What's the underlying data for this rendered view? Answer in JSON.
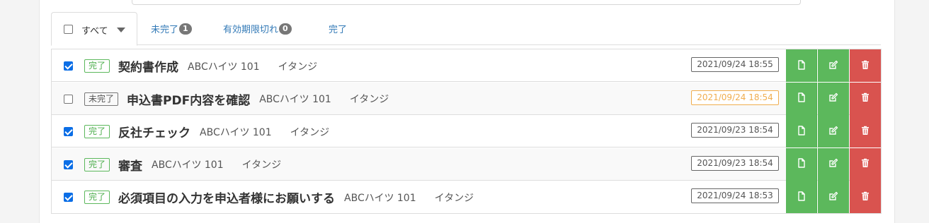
{
  "tabs": {
    "all_label": "すべて",
    "incomplete_label": "未完了",
    "incomplete_count": "1",
    "expired_label": "有効期限切れ",
    "expired_count": "0",
    "complete_label": "完了"
  },
  "tasks": [
    {
      "checked": true,
      "status": "完了",
      "title": "契約書作成",
      "property": "ABCハイツ 101",
      "staff": "イタンジ",
      "date": "2021/09/24 18:55",
      "date_warning": false
    },
    {
      "checked": false,
      "status": "未完了",
      "title": "申込書PDF内容を確認",
      "property": "ABCハイツ 101",
      "staff": "イタンジ",
      "date": "2021/09/24 18:54",
      "date_warning": true
    },
    {
      "checked": true,
      "status": "完了",
      "title": "反社チェック",
      "property": "ABCハイツ 101",
      "staff": "イタンジ",
      "date": "2021/09/23 18:54",
      "date_warning": false
    },
    {
      "checked": true,
      "status": "完了",
      "title": "審査",
      "property": "ABCハイツ 101",
      "staff": "イタンジ",
      "date": "2021/09/23 18:54",
      "date_warning": false
    },
    {
      "checked": true,
      "status": "完了",
      "title": "必須項目の入力を申込者様にお願いする",
      "property": "ABCハイツ 101",
      "staff": "イタンジ",
      "date": "2021/09/24 18:53",
      "date_warning": false
    }
  ],
  "icons": {
    "view": "file-icon",
    "edit": "edit-icon",
    "delete": "trash-icon"
  },
  "colors": {
    "complete": "#5cb85c",
    "danger": "#d9534f",
    "warning": "#f0ad4e",
    "link": "#337ab7",
    "checkbox": "#0b6ee6"
  }
}
